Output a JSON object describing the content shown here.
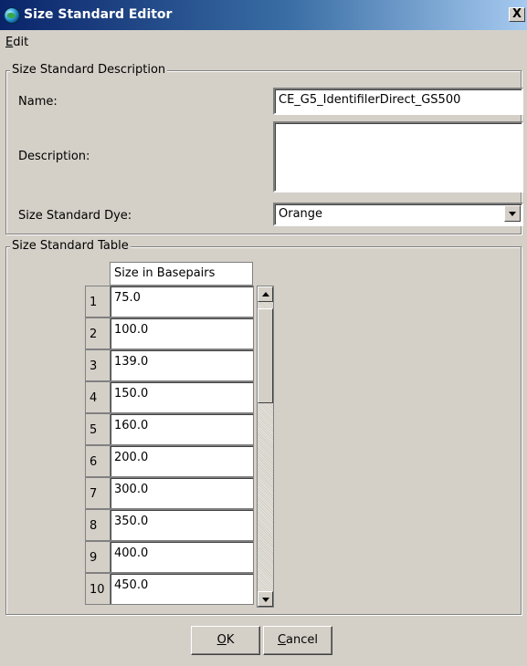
{
  "window": {
    "title": "Size Standard Editor",
    "close_symbol": "X"
  },
  "menu": {
    "edit_mnemonic": "E",
    "edit_rest": "dit"
  },
  "description_group": {
    "title": "Size Standard Description",
    "name_label": "Name:",
    "name_value": "CE_G5_IdentifilerDirect_GS500",
    "description_label": "Description:",
    "description_value": "",
    "dye_label": "Size Standard Dye:",
    "dye_value": "Orange"
  },
  "table_group": {
    "title": "Size Standard Table",
    "column_header": "Size in Basepairs",
    "rows": [
      {
        "num": "1",
        "value": "75.0"
      },
      {
        "num": "2",
        "value": "100.0"
      },
      {
        "num": "3",
        "value": "139.0"
      },
      {
        "num": "4",
        "value": "150.0"
      },
      {
        "num": "5",
        "value": "160.0"
      },
      {
        "num": "6",
        "value": "200.0"
      },
      {
        "num": "7",
        "value": "300.0"
      },
      {
        "num": "8",
        "value": "350.0"
      },
      {
        "num": "9",
        "value": "400.0"
      },
      {
        "num": "10",
        "value": "450.0"
      }
    ]
  },
  "buttons": {
    "ok_mnemonic": "O",
    "ok_rest": "K",
    "cancel_mnemonic": "C",
    "cancel_rest": "ancel"
  }
}
